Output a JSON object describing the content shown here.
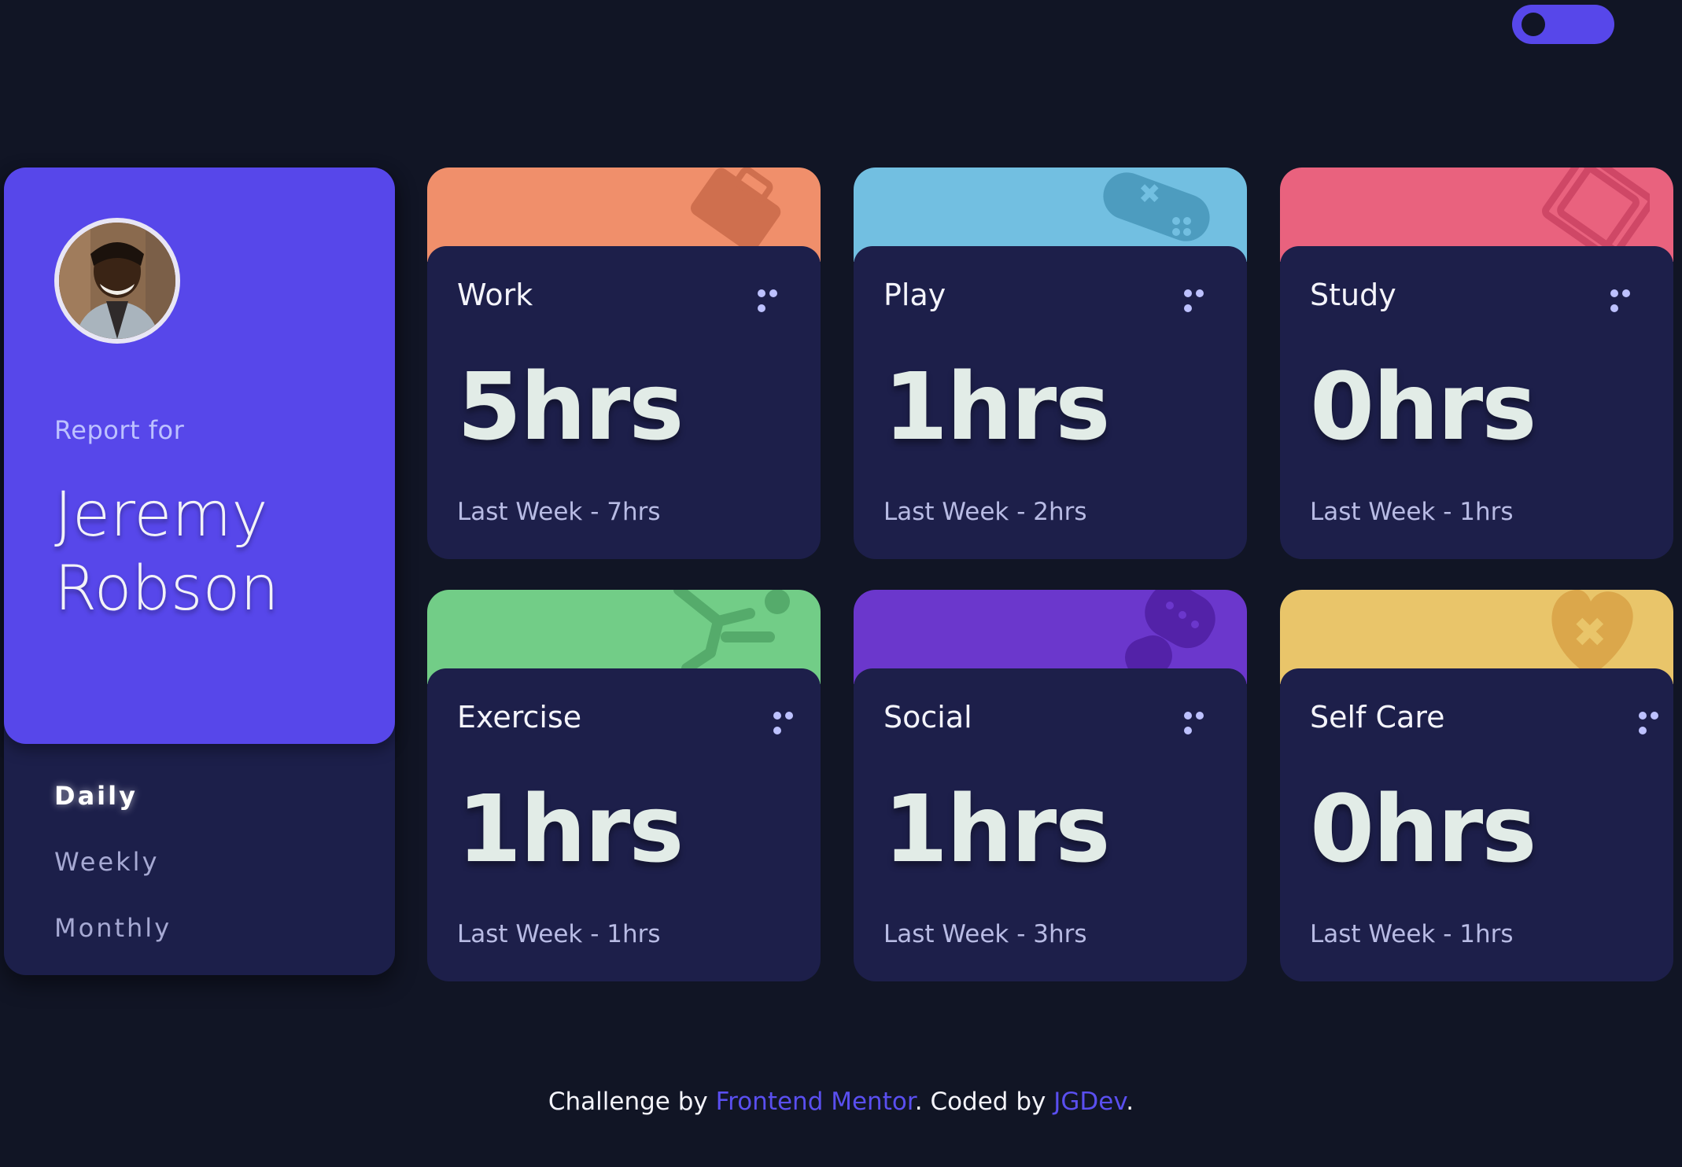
{
  "colors": {
    "background": "#111525",
    "accent": "#5747ea",
    "card_body": "#1d1f4a",
    "link": "#5a4ff0"
  },
  "toggle": {
    "icon": "theme-toggle"
  },
  "profile": {
    "report_label": "Report for",
    "first_name": "Jeremy",
    "last_name": "Robson",
    "avatar_icon": "user-avatar-photo"
  },
  "periods": [
    {
      "label": "Daily",
      "active": true
    },
    {
      "label": "Weekly",
      "active": false
    },
    {
      "label": "Monthly",
      "active": false
    }
  ],
  "cards": [
    {
      "title": "Work",
      "current": "5hrs",
      "previous": "Last Week - 7hrs",
      "color": "#f08f6b",
      "icon": "briefcase-icon"
    },
    {
      "title": "Play",
      "current": "1hrs",
      "previous": "Last Week - 2hrs",
      "color": "#72bfe1",
      "icon": "gamepad-icon"
    },
    {
      "title": "Study",
      "current": "0hrs",
      "previous": "Last Week - 1hrs",
      "color": "#e9627e",
      "icon": "book-icon"
    },
    {
      "title": "Exercise",
      "current": "1hrs",
      "previous": "Last Week - 1hrs",
      "color": "#72cd87",
      "icon": "runner-icon"
    },
    {
      "title": "Social",
      "current": "1hrs",
      "previous": "Last Week - 3hrs",
      "color": "#6b37cc",
      "icon": "chat-bubble-icon"
    },
    {
      "title": "Self Care",
      "current": "0hrs",
      "previous": "Last Week - 1hrs",
      "color": "#e9c56a",
      "icon": "heart-icon"
    }
  ],
  "footer": {
    "prefix": "Challenge by ",
    "link1": "Frontend Mentor",
    "middle": ". Coded by ",
    "link2": "JGDev",
    "suffix": "."
  }
}
